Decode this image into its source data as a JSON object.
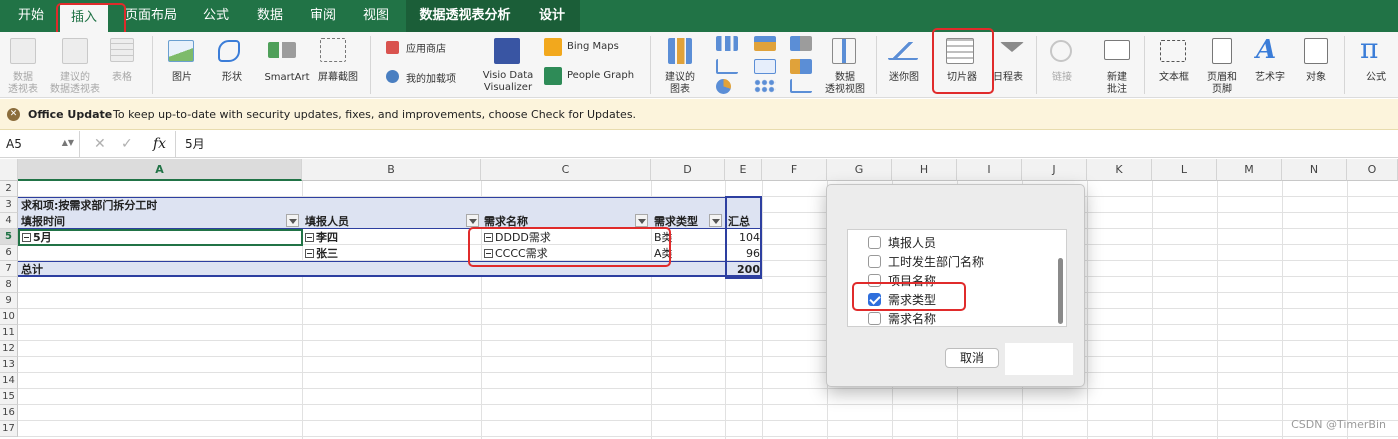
{
  "ribbon_tabs": [
    "开始",
    "插入",
    "页面布局",
    "公式",
    "数据",
    "审阅",
    "视图",
    "数据透视表分析",
    "设计"
  ],
  "ribbon": {
    "pivot_table": "数据\n透视表",
    "recommended_pivot": "建议的\n数据透视表",
    "table": "表格",
    "pictures": "图片",
    "shapes": "形状",
    "smartart": "SmartArt",
    "screenshot": "屏幕截图",
    "store": "应用商店",
    "my_addins": "我的加载项",
    "visio": "Visio Data\nVisualizer",
    "bing_maps": "Bing Maps",
    "people_graph": "People Graph",
    "recommended_charts": "建议的\n图表",
    "pivot_chart": "数据\n透视视图",
    "sparklines": "迷你图",
    "slicer": "切片器",
    "timeline": "日程表",
    "link": "链接",
    "new_comment": "新建\n批注",
    "text_box": "文本框",
    "header_footer": "页眉和\n页脚",
    "wordart": "艺术字",
    "object": "对象",
    "equation": "公式"
  },
  "update_bar": {
    "title": "Office Update",
    "message": "To keep up-to-date with security updates, fixes, and improvements, choose Check for Updates."
  },
  "formula_bar": {
    "name_box": "A5",
    "fx": "fx",
    "value": "5月"
  },
  "columns": [
    "A",
    "B",
    "C",
    "D",
    "E",
    "F",
    "G",
    "H",
    "I",
    "J",
    "K",
    "L",
    "M",
    "N",
    "O"
  ],
  "rows": [
    "2",
    "3",
    "4",
    "5",
    "6",
    "7",
    "8",
    "9",
    "10",
    "11",
    "12",
    "13",
    "14",
    "15",
    "16",
    "17"
  ],
  "pivot": {
    "title": "求和项:按需求部门拆分工时",
    "headers": {
      "time": "填报时间",
      "person": "填报人员",
      "demand": "需求名称",
      "type": "需求类型",
      "total": "汇总"
    },
    "month": "5月",
    "rows": [
      {
        "person": "李四",
        "demand": "DDDD需求",
        "type": "B类",
        "value": "104"
      },
      {
        "person": "张三",
        "demand": "CCCC需求",
        "type": "A类",
        "value": "96"
      }
    ],
    "grand_label": "总计",
    "grand_value": "200"
  },
  "dialog": {
    "options": [
      {
        "label": "填报人员",
        "checked": false
      },
      {
        "label": "工时发生部门名称",
        "checked": false
      },
      {
        "label": "项目名称",
        "checked": false
      },
      {
        "label": "需求类型",
        "checked": true
      },
      {
        "label": "需求名称",
        "checked": false
      }
    ],
    "cancel": "取消"
  },
  "watermark": "CSDN @TimerBin"
}
